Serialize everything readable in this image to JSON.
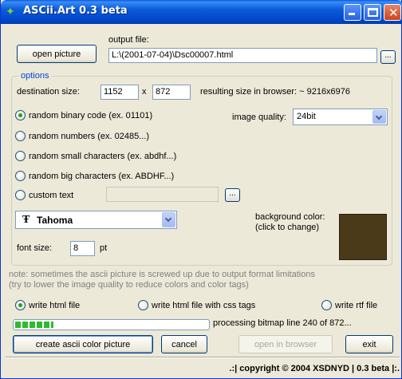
{
  "window": {
    "title": "ASCii.Art 0.3 beta",
    "title_icon": "✦"
  },
  "file": {
    "open_button": "open picture",
    "output_label": "output file:",
    "output_value": "L:\\(2001-07-04)\\Dsc00007.html",
    "browse_label": "..."
  },
  "options": {
    "group_label": "options",
    "dest_size_label": "destination size:",
    "width": "1152",
    "x_label": "x",
    "height": "872",
    "result_label": "resulting size in browser: ~ 9216x6976",
    "quality_label": "image quality:",
    "quality_value": "24bit",
    "radios": [
      {
        "label": "random binary code (ex. 01101)",
        "checked": true
      },
      {
        "label": "random numbers (ex. 02485...)",
        "checked": false
      },
      {
        "label": "random small characters (ex. abdhf...)",
        "checked": false
      },
      {
        "label": "random big characters (ex. ABDHF...)",
        "checked": false
      },
      {
        "label": "custom text",
        "checked": false
      }
    ],
    "custom_text_value": "",
    "custom_browse_label": "...",
    "font_icon": "Ŧ",
    "font_value": "Tahoma",
    "font_size_label": "font size:",
    "font_size_value": "8",
    "font_size_unit": "pt",
    "bg_label_line1": "background color:",
    "bg_label_line2": "(click to change)",
    "bg_color": "#4a3a1a"
  },
  "note": {
    "line1": "note: sometimes the ascii picture is screwed up due to output format limitations",
    "line2": "(try to lower the image quality to reduce colors and color tags)"
  },
  "output_formats": [
    {
      "label": "write html file",
      "checked": true
    },
    {
      "label": "write html file with css tags",
      "checked": false
    },
    {
      "label": "write rtf file",
      "checked": false
    }
  ],
  "progress": {
    "fraction": 0.2,
    "status": "processing bitmap line 240 of 872..."
  },
  "actions": {
    "create": "create ascii color picture",
    "cancel": "cancel",
    "open_browser": "open in browser",
    "exit": "exit"
  },
  "statusbar": {
    "text": ".:| copyright © 2004 XSDNYD | 0.3 beta |:."
  }
}
